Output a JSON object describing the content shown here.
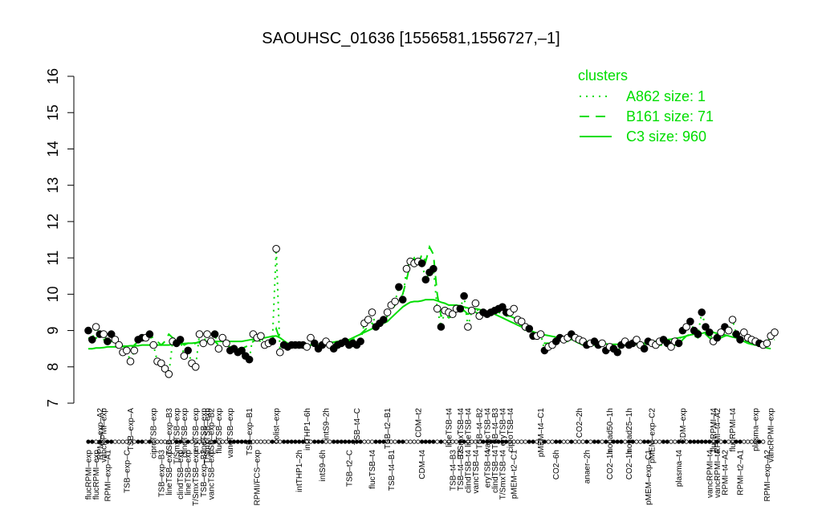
{
  "chart_data": {
    "type": "line",
    "title": "SAOUHSC_01636 [1556581,1556727,–1]",
    "xlabel": "",
    "ylabel": "",
    "ylim": [
      7,
      16
    ],
    "yticks": [
      7,
      8,
      9,
      10,
      11,
      12,
      13,
      14,
      15,
      16
    ],
    "grid": false,
    "legend": {
      "title": "clusters",
      "placement": "top-right",
      "entries": [
        {
          "label": "A862 size: 1",
          "style": "dotted"
        },
        {
          "label": "B161 size: 71",
          "style": "dashed"
        },
        {
          "label": "C3 size: 960",
          "style": "solid"
        }
      ]
    },
    "colors": {
      "line": "#00dd00",
      "axis": "#000000",
      "filled": "#000000",
      "open": "#ffffff"
    },
    "upper_labels": [
      {
        "i": 3,
        "text": "RPMI–exp–A2"
      },
      {
        "i": 4,
        "text": "vancRPMI–exp"
      },
      {
        "i": 11,
        "text": "TSB–exp–A"
      },
      {
        "i": 17,
        "text": "ciproTSB–exp"
      },
      {
        "i": 21,
        "text": "TSB–exp–B3"
      },
      {
        "i": 23,
        "text": "T/SmxTSB–exp"
      },
      {
        "i": 25,
        "text": "clindTSB–exp"
      },
      {
        "i": 28,
        "text": "eryTSB–exp"
      },
      {
        "i": 30,
        "text": "lineTSB–exp"
      },
      {
        "i": 31,
        "text": "T/SmxTSB–exp"
      },
      {
        "i": 32,
        "text": "TSB–exp–B2"
      },
      {
        "i": 34,
        "text": "flucTSB–exp"
      },
      {
        "i": 37,
        "text": "vancTSB–exp"
      },
      {
        "i": 42,
        "text": "TSB–exp–B1"
      },
      {
        "i": 49,
        "text": "colist–exp"
      },
      {
        "i": 57,
        "text": "intTHP1–6h"
      },
      {
        "i": 62,
        "text": "intS9–2h"
      },
      {
        "i": 70,
        "text": "TSB–t4–C"
      },
      {
        "i": 78,
        "text": "TSB–t2–B1"
      },
      {
        "i": 86,
        "text": "CDM–t2"
      },
      {
        "i": 94,
        "text": "lineTSB–t4"
      },
      {
        "i": 97,
        "text": "T/SmxTSB–t4"
      },
      {
        "i": 99,
        "text": "lineTSB–t4"
      },
      {
        "i": 102,
        "text": "TSB–t4–B2"
      },
      {
        "i": 104,
        "text": "vancTSB–t4"
      },
      {
        "i": 106,
        "text": "TSB–t4–B3"
      },
      {
        "i": 108,
        "text": "eryTSB–t4"
      },
      {
        "i": 110,
        "text": "ciproTSB–t4"
      },
      {
        "i": 118,
        "text": "pMEM–t4–C1"
      },
      {
        "i": 128,
        "text": "CO2–2h"
      },
      {
        "i": 136,
        "text": "nonad50–1h"
      },
      {
        "i": 141,
        "text": "nonad25–1h"
      },
      {
        "i": 147,
        "text": "pMEM–exp–C2"
      },
      {
        "i": 155,
        "text": "CDM–exp"
      },
      {
        "i": 163,
        "text": "flucRPMI–t4"
      },
      {
        "i": 164,
        "text": "RPMI–t4–A2"
      },
      {
        "i": 168,
        "text": "flucRPMI–t4"
      },
      {
        "i": 174,
        "text": "plasma–exp"
      },
      {
        "i": 178,
        "text": "vancRPMI–exp"
      }
    ],
    "lower_labels": [
      {
        "i": 0,
        "text": "flucRPMI–exp"
      },
      {
        "i": 2,
        "text": "flucRPMI–exp"
      },
      {
        "i": 5,
        "text": "RPMI–exp–A1"
      },
      {
        "i": 10,
        "text": "TSB–exp–C"
      },
      {
        "i": 19,
        "text": "TSB–exp–B3"
      },
      {
        "i": 21,
        "text": "lineTSB–exp"
      },
      {
        "i": 24,
        "text": "clindTSB–exp"
      },
      {
        "i": 26,
        "text": "lineTSB–exp"
      },
      {
        "i": 28,
        "text": "T/SmxTSB–exp"
      },
      {
        "i": 30,
        "text": "TSB–exp–B2"
      },
      {
        "i": 32,
        "text": "vancTSB–exp"
      },
      {
        "i": 44,
        "text": "RPMI/FCS–exp"
      },
      {
        "i": 55,
        "text": "intTHP1–2h"
      },
      {
        "i": 61,
        "text": "intS9–6h"
      },
      {
        "i": 68,
        "text": "TSB–t2–C"
      },
      {
        "i": 74,
        "text": "flucTSB–t4"
      },
      {
        "i": 79,
        "text": "TSB–t4–B1"
      },
      {
        "i": 87,
        "text": "CDM–t4"
      },
      {
        "i": 95,
        "text": "TSB–t4–B3"
      },
      {
        "i": 97,
        "text": "TSB–t4–B3"
      },
      {
        "i": 99,
        "text": "clindTSB–t4"
      },
      {
        "i": 101,
        "text": "vancTSB–t4"
      },
      {
        "i": 104,
        "text": "eryTSB–t4"
      },
      {
        "i": 106,
        "text": "clindTSB–t4"
      },
      {
        "i": 108,
        "text": "T/SmxTSB–t4"
      },
      {
        "i": 111,
        "text": "pMEM–t2–C1"
      },
      {
        "i": 122,
        "text": "CO2–6h"
      },
      {
        "i": 130,
        "text": "anaer–2h"
      },
      {
        "i": 136,
        "text": "CO2–1h"
      },
      {
        "i": 141,
        "text": "CO2–1h"
      },
      {
        "i": 146,
        "text": "pMEM–exp–C1"
      },
      {
        "i": 154,
        "text": "plasma–t4"
      },
      {
        "i": 162,
        "text": "vancRPMI–t4"
      },
      {
        "i": 164,
        "text": "vancRPMI–t4"
      },
      {
        "i": 166,
        "text": "RPMI–t4–A2"
      },
      {
        "i": 170,
        "text": "RPMI–t2–A1"
      },
      {
        "i": 177,
        "text": "RPMI–exp–A2"
      }
    ],
    "series": [
      {
        "name": "A862 size: 1",
        "style": "dotted",
        "y": [
          9.0,
          8.75,
          9.1,
          8.9,
          8.9,
          8.7,
          8.9,
          8.75,
          8.6,
          8.4,
          8.45,
          8.15,
          8.45,
          8.75,
          8.8,
          8.8,
          8.9,
          8.6,
          8.15,
          8.1,
          7.95,
          7.8,
          8.7,
          8.65,
          8.75,
          8.3,
          8.45,
          8.1,
          8.0,
          8.9,
          8.65,
          8.9,
          8.7,
          8.9,
          8.5,
          8.8,
          8.65,
          8.45,
          8.5,
          8.4,
          8.45,
          8.3,
          8.2,
          8.9,
          8.8,
          8.85,
          8.6,
          8.65,
          8.7,
          11.25,
          8.4,
          8.6,
          8.55,
          8.6,
          8.6,
          8.6,
          8.6,
          8.55,
          8.8,
          8.65,
          8.5,
          8.6,
          8.7,
          8.6,
          8.5,
          8.6,
          8.65,
          8.7,
          8.6,
          8.65,
          8.6,
          8.7,
          9.2,
          9.3,
          9.5,
          9.1,
          9.2,
          9.3,
          9.5,
          9.7,
          9.8,
          10.2,
          9.85,
          10.7,
          10.9,
          10.85,
          10.9,
          10.85,
          10.4,
          10.6,
          10.7,
          9.6,
          9.1,
          9.55,
          9.5,
          9.45,
          9.6,
          9.6,
          9.95,
          9.1,
          9.55,
          9.75,
          9.4,
          9.5,
          9.45,
          9.5,
          9.55,
          9.6,
          9.65,
          9.5,
          9.5,
          9.6,
          9.3,
          9.25,
          9.1,
          9.05,
          8.85,
          8.85,
          8.9,
          8.45,
          8.55,
          8.6,
          8.7,
          8.8,
          8.75,
          8.8,
          8.9,
          8.8,
          8.75,
          8.7,
          8.6,
          8.65,
          8.7,
          8.6,
          8.65,
          8.45,
          8.55,
          8.5,
          8.4,
          8.6,
          8.7,
          8.6,
          8.65,
          8.75,
          8.6,
          8.5,
          8.7,
          8.65,
          8.6,
          8.7,
          8.75,
          8.65,
          8.55,
          8.7,
          8.65,
          9.0,
          9.1,
          9.25,
          9.0,
          8.9,
          9.5,
          9.1,
          8.95,
          8.7,
          8.8,
          8.95,
          9.1,
          9.0,
          9.3,
          8.9,
          8.75,
          8.95,
          8.8,
          8.75,
          8.7,
          8.65,
          8.6,
          8.65,
          8.85,
          8.95
        ],
        "marker_filled": [
          true,
          true,
          false,
          true,
          false,
          true,
          true,
          false,
          false,
          false,
          false,
          false,
          false,
          true,
          true,
          false,
          true,
          false,
          false,
          false,
          false,
          false,
          false,
          true,
          true,
          false,
          true,
          false,
          false,
          false,
          false,
          false,
          false,
          true,
          false,
          false,
          false,
          true,
          true,
          true,
          true,
          true,
          true,
          false,
          false,
          false,
          false,
          false,
          true,
          false,
          false,
          true,
          true,
          true,
          true,
          true,
          true,
          false,
          false,
          true,
          true,
          true,
          false,
          false,
          true,
          true,
          true,
          true,
          true,
          true,
          true,
          true,
          false,
          false,
          false,
          true,
          true,
          true,
          false,
          false,
          false,
          true,
          true,
          false,
          false,
          false,
          false,
          true,
          true,
          true,
          true,
          false,
          true,
          false,
          false,
          false,
          false,
          true,
          true,
          false,
          false,
          false,
          false,
          true,
          true,
          true,
          true,
          true,
          true,
          true,
          false,
          false,
          false,
          false,
          false,
          true,
          true,
          false,
          false,
          true,
          false,
          false,
          true,
          true,
          false,
          false,
          true,
          false,
          false,
          false,
          true,
          false,
          true,
          true,
          false,
          true,
          false,
          true,
          true,
          true,
          false,
          true,
          true,
          false,
          false,
          true,
          true,
          false,
          false,
          false,
          true,
          true,
          false,
          false,
          true,
          true,
          false,
          true,
          true,
          true,
          true,
          true,
          true,
          false,
          true,
          false,
          true,
          false,
          false,
          true,
          true,
          false,
          false,
          false,
          false,
          true,
          false
        ]
      },
      {
        "name": "B161 size: 71",
        "style": "dashed",
        "y": [
          8.8,
          8.75,
          8.8,
          8.75,
          8.75,
          8.75,
          8.7,
          8.7,
          8.65,
          8.55,
          8.55,
          8.5,
          8.6,
          8.7,
          8.8,
          8.85,
          8.85,
          8.8,
          8.7,
          8.6,
          8.7,
          8.9,
          8.8,
          8.75,
          8.7,
          8.6,
          8.65,
          8.6,
          8.65,
          8.7,
          8.7,
          8.75,
          8.7,
          8.7,
          8.6,
          8.65,
          8.6,
          8.55,
          8.55,
          8.5,
          8.5,
          8.55,
          8.6,
          8.7,
          8.75,
          8.7,
          8.7,
          8.7,
          8.75,
          9.05,
          8.75,
          8.7,
          8.65,
          8.6,
          8.6,
          8.6,
          8.6,
          8.6,
          8.6,
          8.6,
          8.6,
          8.6,
          8.6,
          8.6,
          8.6,
          8.6,
          8.65,
          8.7,
          8.7,
          8.75,
          8.8,
          8.9,
          9.0,
          9.1,
          9.2,
          9.1,
          9.15,
          9.25,
          9.4,
          9.55,
          9.7,
          9.85,
          10.0,
          10.4,
          10.85,
          11.0,
          10.8,
          11.1,
          10.9,
          11.3,
          11.1,
          10.0,
          9.4,
          9.45,
          9.35,
          9.4,
          9.45,
          9.5,
          9.55,
          9.45,
          9.5,
          9.5,
          9.45,
          9.45,
          9.45,
          9.5,
          9.5,
          9.5,
          9.45,
          9.4,
          9.4,
          9.35,
          9.25,
          9.15,
          9.0,
          8.95,
          8.85,
          8.8,
          8.75,
          8.65,
          8.65,
          8.65,
          8.7,
          8.75,
          8.75,
          8.7,
          8.7,
          8.7,
          8.65,
          8.6,
          8.6,
          8.6,
          8.6,
          8.6,
          8.6,
          8.55,
          8.55,
          8.55,
          8.5,
          8.55,
          8.6,
          8.6,
          8.6,
          8.6,
          8.6,
          8.6,
          8.6,
          8.6,
          8.6,
          8.6,
          8.6,
          8.6,
          8.55,
          8.6,
          8.6,
          8.75,
          8.85,
          8.9,
          8.85,
          8.8,
          9.0,
          8.9,
          8.8,
          8.7,
          8.75,
          8.8,
          8.85,
          8.85,
          8.9,
          8.8,
          8.7,
          8.75,
          8.7,
          8.65,
          8.65,
          8.6,
          8.6,
          8.6,
          8.7,
          8.75
        ]
      },
      {
        "name": "C3 size: 960",
        "style": "solid",
        "y": [
          8.5,
          8.5,
          8.52,
          8.52,
          8.53,
          8.55,
          8.55,
          8.55,
          8.56,
          8.57,
          8.57,
          8.58,
          8.58,
          8.58,
          8.6,
          8.6,
          8.6,
          8.6,
          8.6,
          8.6,
          8.6,
          8.6,
          8.62,
          8.62,
          8.63,
          8.64,
          8.65,
          8.65,
          8.66,
          8.67,
          8.68,
          8.7,
          8.7,
          8.7,
          8.7,
          8.7,
          8.7,
          8.7,
          8.7,
          8.7,
          8.7,
          8.72,
          8.74,
          8.76,
          8.78,
          8.8,
          8.8,
          8.82,
          8.84,
          8.85,
          8.8,
          8.72,
          8.65,
          8.6,
          8.58,
          8.58,
          8.58,
          8.58,
          8.6,
          8.6,
          8.6,
          8.62,
          8.65,
          8.67,
          8.68,
          8.7,
          8.7,
          8.72,
          8.75,
          8.8,
          8.85,
          8.9,
          8.95,
          9.0,
          9.05,
          9.1,
          9.15,
          9.2,
          9.25,
          9.35,
          9.45,
          9.55,
          9.65,
          9.72,
          9.78,
          9.8,
          9.8,
          9.82,
          9.85,
          9.85,
          9.85,
          9.82,
          9.78,
          9.75,
          9.7,
          9.7,
          9.7,
          9.68,
          9.65,
          9.62,
          9.6,
          9.6,
          9.58,
          9.55,
          9.52,
          9.5,
          9.45,
          9.4,
          9.35,
          9.3,
          9.25,
          9.2,
          9.15,
          9.1,
          9.05,
          9.0,
          8.97,
          8.93,
          8.9,
          8.88,
          8.86,
          8.84,
          8.82,
          8.8,
          8.78,
          8.76,
          8.75,
          8.74,
          8.72,
          8.7,
          8.7,
          8.68,
          8.66,
          8.65,
          8.64,
          8.63,
          8.62,
          8.62,
          8.62,
          8.62,
          8.62,
          8.62,
          8.62,
          8.63,
          8.64,
          8.65,
          8.66,
          8.68,
          8.7,
          8.72,
          8.74,
          8.75,
          8.76,
          8.78,
          8.8,
          8.82,
          8.85,
          8.88,
          8.9,
          8.9,
          8.92,
          8.95,
          8.95,
          8.95,
          8.92,
          8.9,
          8.88,
          8.85,
          8.82,
          8.8,
          8.75,
          8.7,
          8.65,
          8.62,
          8.6,
          8.58,
          8.55,
          8.52,
          8.5
        ]
      }
    ]
  }
}
